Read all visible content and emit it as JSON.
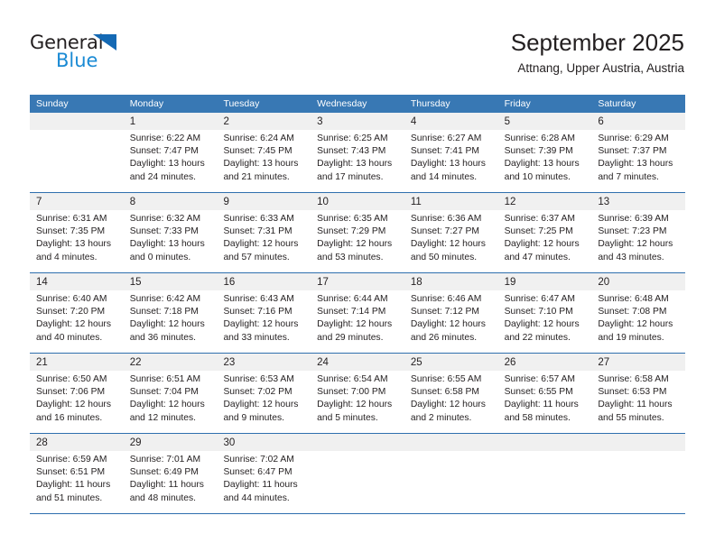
{
  "brand": {
    "name_part1": "General",
    "name_part2": "Blue",
    "triangle_color": "#1469b4",
    "blue_color": "#1a8ad4"
  },
  "header": {
    "title": "September 2025",
    "subtitle": "Attnang, Upper Austria, Austria"
  },
  "colors": {
    "header_row_bg": "#3878b4",
    "row_divider": "#2f6fae",
    "daynum_band_bg": "#f0f0f0",
    "text": "#231f20"
  },
  "weekdays": [
    "Sunday",
    "Monday",
    "Tuesday",
    "Wednesday",
    "Thursday",
    "Friday",
    "Saturday"
  ],
  "weeks": [
    [
      {
        "day": "",
        "lines": []
      },
      {
        "day": "1",
        "lines": [
          "Sunrise: 6:22 AM",
          "Sunset: 7:47 PM",
          "Daylight: 13 hours",
          "and 24 minutes."
        ]
      },
      {
        "day": "2",
        "lines": [
          "Sunrise: 6:24 AM",
          "Sunset: 7:45 PM",
          "Daylight: 13 hours",
          "and 21 minutes."
        ]
      },
      {
        "day": "3",
        "lines": [
          "Sunrise: 6:25 AM",
          "Sunset: 7:43 PM",
          "Daylight: 13 hours",
          "and 17 minutes."
        ]
      },
      {
        "day": "4",
        "lines": [
          "Sunrise: 6:27 AM",
          "Sunset: 7:41 PM",
          "Daylight: 13 hours",
          "and 14 minutes."
        ]
      },
      {
        "day": "5",
        "lines": [
          "Sunrise: 6:28 AM",
          "Sunset: 7:39 PM",
          "Daylight: 13 hours",
          "and 10 minutes."
        ]
      },
      {
        "day": "6",
        "lines": [
          "Sunrise: 6:29 AM",
          "Sunset: 7:37 PM",
          "Daylight: 13 hours",
          "and 7 minutes."
        ]
      }
    ],
    [
      {
        "day": "7",
        "lines": [
          "Sunrise: 6:31 AM",
          "Sunset: 7:35 PM",
          "Daylight: 13 hours",
          "and 4 minutes."
        ]
      },
      {
        "day": "8",
        "lines": [
          "Sunrise: 6:32 AM",
          "Sunset: 7:33 PM",
          "Daylight: 13 hours",
          "and 0 minutes."
        ]
      },
      {
        "day": "9",
        "lines": [
          "Sunrise: 6:33 AM",
          "Sunset: 7:31 PM",
          "Daylight: 12 hours",
          "and 57 minutes."
        ]
      },
      {
        "day": "10",
        "lines": [
          "Sunrise: 6:35 AM",
          "Sunset: 7:29 PM",
          "Daylight: 12 hours",
          "and 53 minutes."
        ]
      },
      {
        "day": "11",
        "lines": [
          "Sunrise: 6:36 AM",
          "Sunset: 7:27 PM",
          "Daylight: 12 hours",
          "and 50 minutes."
        ]
      },
      {
        "day": "12",
        "lines": [
          "Sunrise: 6:37 AM",
          "Sunset: 7:25 PM",
          "Daylight: 12 hours",
          "and 47 minutes."
        ]
      },
      {
        "day": "13",
        "lines": [
          "Sunrise: 6:39 AM",
          "Sunset: 7:23 PM",
          "Daylight: 12 hours",
          "and 43 minutes."
        ]
      }
    ],
    [
      {
        "day": "14",
        "lines": [
          "Sunrise: 6:40 AM",
          "Sunset: 7:20 PM",
          "Daylight: 12 hours",
          "and 40 minutes."
        ]
      },
      {
        "day": "15",
        "lines": [
          "Sunrise: 6:42 AM",
          "Sunset: 7:18 PM",
          "Daylight: 12 hours",
          "and 36 minutes."
        ]
      },
      {
        "day": "16",
        "lines": [
          "Sunrise: 6:43 AM",
          "Sunset: 7:16 PM",
          "Daylight: 12 hours",
          "and 33 minutes."
        ]
      },
      {
        "day": "17",
        "lines": [
          "Sunrise: 6:44 AM",
          "Sunset: 7:14 PM",
          "Daylight: 12 hours",
          "and 29 minutes."
        ]
      },
      {
        "day": "18",
        "lines": [
          "Sunrise: 6:46 AM",
          "Sunset: 7:12 PM",
          "Daylight: 12 hours",
          "and 26 minutes."
        ]
      },
      {
        "day": "19",
        "lines": [
          "Sunrise: 6:47 AM",
          "Sunset: 7:10 PM",
          "Daylight: 12 hours",
          "and 22 minutes."
        ]
      },
      {
        "day": "20",
        "lines": [
          "Sunrise: 6:48 AM",
          "Sunset: 7:08 PM",
          "Daylight: 12 hours",
          "and 19 minutes."
        ]
      }
    ],
    [
      {
        "day": "21",
        "lines": [
          "Sunrise: 6:50 AM",
          "Sunset: 7:06 PM",
          "Daylight: 12 hours",
          "and 16 minutes."
        ]
      },
      {
        "day": "22",
        "lines": [
          "Sunrise: 6:51 AM",
          "Sunset: 7:04 PM",
          "Daylight: 12 hours",
          "and 12 minutes."
        ]
      },
      {
        "day": "23",
        "lines": [
          "Sunrise: 6:53 AM",
          "Sunset: 7:02 PM",
          "Daylight: 12 hours",
          "and 9 minutes."
        ]
      },
      {
        "day": "24",
        "lines": [
          "Sunrise: 6:54 AM",
          "Sunset: 7:00 PM",
          "Daylight: 12 hours",
          "and 5 minutes."
        ]
      },
      {
        "day": "25",
        "lines": [
          "Sunrise: 6:55 AM",
          "Sunset: 6:58 PM",
          "Daylight: 12 hours",
          "and 2 minutes."
        ]
      },
      {
        "day": "26",
        "lines": [
          "Sunrise: 6:57 AM",
          "Sunset: 6:55 PM",
          "Daylight: 11 hours",
          "and 58 minutes."
        ]
      },
      {
        "day": "27",
        "lines": [
          "Sunrise: 6:58 AM",
          "Sunset: 6:53 PM",
          "Daylight: 11 hours",
          "and 55 minutes."
        ]
      }
    ],
    [
      {
        "day": "28",
        "lines": [
          "Sunrise: 6:59 AM",
          "Sunset: 6:51 PM",
          "Daylight: 11 hours",
          "and 51 minutes."
        ]
      },
      {
        "day": "29",
        "lines": [
          "Sunrise: 7:01 AM",
          "Sunset: 6:49 PM",
          "Daylight: 11 hours",
          "and 48 minutes."
        ]
      },
      {
        "day": "30",
        "lines": [
          "Sunrise: 7:02 AM",
          "Sunset: 6:47 PM",
          "Daylight: 11 hours",
          "and 44 minutes."
        ]
      },
      {
        "day": "",
        "lines": []
      },
      {
        "day": "",
        "lines": []
      },
      {
        "day": "",
        "lines": []
      },
      {
        "day": "",
        "lines": []
      }
    ]
  ]
}
